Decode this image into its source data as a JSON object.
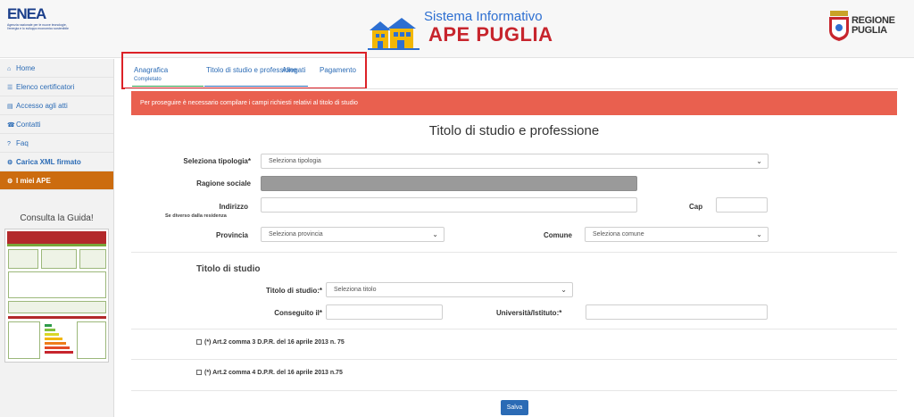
{
  "header": {
    "enea_logo": "ENEA",
    "enea_subtitle_1": "Agenzia nazionale per le nuove tecnologie,",
    "enea_subtitle_2": "l'energia e lo sviluppo economico sostenibile",
    "title_line1": "Sistema Informativo",
    "title_line2": "APE PUGLIA",
    "regione_line1": "REGIONE",
    "regione_line2": "PUGLIA"
  },
  "sidebar": {
    "items": [
      {
        "icon": "home-icon",
        "glyph": "⌂",
        "label": "Home"
      },
      {
        "icon": "list-icon",
        "glyph": "☰",
        "label": "Elenco certificatori"
      },
      {
        "icon": "document-icon",
        "glyph": "▤",
        "label": "Accesso agli atti"
      },
      {
        "icon": "phone-icon",
        "glyph": "☎",
        "label": "Contatti"
      },
      {
        "icon": "question-icon",
        "glyph": "?",
        "label": "Faq"
      },
      {
        "icon": "gear-icon",
        "glyph": "⚙",
        "label": "Carica XML firmato"
      },
      {
        "icon": "gear-icon",
        "glyph": "⚙",
        "label": "I miei APE"
      }
    ],
    "guide_title": "Consulta la Guida!"
  },
  "tabs": [
    {
      "label": "Anagrafica",
      "sub": "Completato"
    },
    {
      "label": "Titolo di studio e professione"
    },
    {
      "label": "Allegati"
    },
    {
      "label": "Pagamento"
    }
  ],
  "alert": "Per proseguire è necessario compilare i campi richiesti relativi al titolo di studio",
  "form": {
    "title": "Titolo di studio e professione",
    "tipologia_label": "Seleziona tipologia*",
    "tipologia_value": "Seleziona tipologia",
    "ragione_label": "Ragione sociale",
    "indirizzo_label": "Indirizzo",
    "indirizzo_sub": "Se diverso dalla residenza",
    "cap_label": "Cap",
    "provincia_label": "Provincia",
    "provincia_value": "Seleziona provincia",
    "comune_label": "Comune",
    "comune_value": "Seleziona comune",
    "section_title": "Titolo di studio",
    "titolo_label": "Titolo di studio:*",
    "titolo_value": "Seleziona titolo",
    "conseguito_label": "Conseguito il*",
    "universita_label": "Università/Istituto:*",
    "check1": "(*) Art.2 comma 3 D.P.R. del 16 aprile 2013 n. 75",
    "check2": "(*) Art.2 comma 4 D.P.R. del 16 aprile 2013 n.75",
    "save": "Salva"
  },
  "colors": {
    "accent_blue": "#2b6bb5",
    "alert_red": "#e9604f",
    "active_orange": "#cc6c0f",
    "title_red": "#c7252d"
  }
}
